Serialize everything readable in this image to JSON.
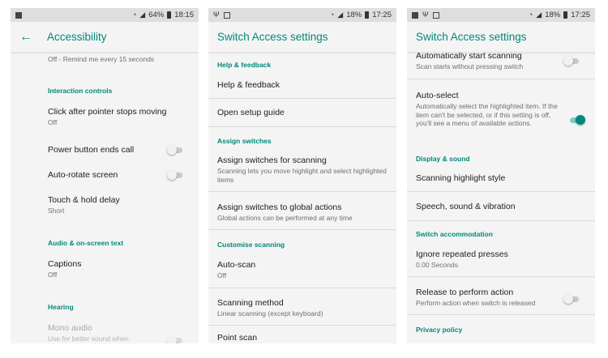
{
  "screen1": {
    "status": {
      "battery": "64%",
      "time": "18:15"
    },
    "title": "Accessibility",
    "top_sub": "Off - Remind me every 15 seconds",
    "h_interaction": "Interaction controls",
    "click_title": "Click after pointer stops moving",
    "click_sub": "Off",
    "power_title": "Power button ends call",
    "autorotate_title": "Auto-rotate screen",
    "touch_title": "Touch & hold delay",
    "touch_sub": "Short",
    "h_audio": "Audio & on-screen text",
    "captions_title": "Captions",
    "captions_sub": "Off",
    "h_hearing": "Hearing",
    "mono_title": "Mono audio",
    "mono_sub": "Use for better sound when"
  },
  "screen2": {
    "status": {
      "battery": "18%",
      "time": "17:25"
    },
    "title": "Switch Access settings",
    "h_help": "Help & feedback",
    "help_title": "Help & feedback",
    "setup_title": "Open setup guide",
    "h_assign": "Assign switches",
    "scan_title": "Assign switches for scanning",
    "scan_sub": "Scanning lets you move highlight and select highlighted items",
    "global_title": "Assign switches to global actions",
    "global_sub": "Global actions can be performed at any time",
    "h_custom": "Customise scanning",
    "autoscan_title": "Auto-scan",
    "autoscan_sub": "Off",
    "method_title": "Scanning method",
    "method_sub": "Linear scanning (except keyboard)",
    "point_title": "Point scan"
  },
  "screen3": {
    "status": {
      "battery": "18%",
      "time": "17:25"
    },
    "title": "Switch Access settings",
    "autostart_title": "Automatically start scanning",
    "autostart_sub": "Scan starts without pressing switch",
    "autoselect_title": "Auto-select",
    "autoselect_sub": "Automatically select the highlighted item. If the item can't be selected, or if this setting is off, you'll see a menu of available actions.",
    "h_display": "Display & sound",
    "highlight_title": "Scanning highlight style",
    "speech_title": "Speech, sound & vibration",
    "h_accommodation": "Switch accommodation",
    "ignore_title": "Ignore repeated presses",
    "ignore_sub": "0.00 Seconds",
    "release_title": "Release to perform action",
    "release_sub": "Perform action when switch is released",
    "h_privacy": "Privacy policy"
  },
  "toggles": {
    "power_button_ends_call": false,
    "auto_rotate_screen": false,
    "mono_audio": false,
    "auto_start_scanning": false,
    "auto_select": true,
    "release_to_perform_action": false
  },
  "icons": [
    "image-icon",
    "wifi-icon",
    "signal-icon",
    "usb-icon",
    "debug-icon",
    "battery-icon",
    "back-arrow-icon"
  ],
  "colors": {
    "accent": "#00897b",
    "statusbar": "#dedede",
    "background": "#f4f4f4"
  }
}
